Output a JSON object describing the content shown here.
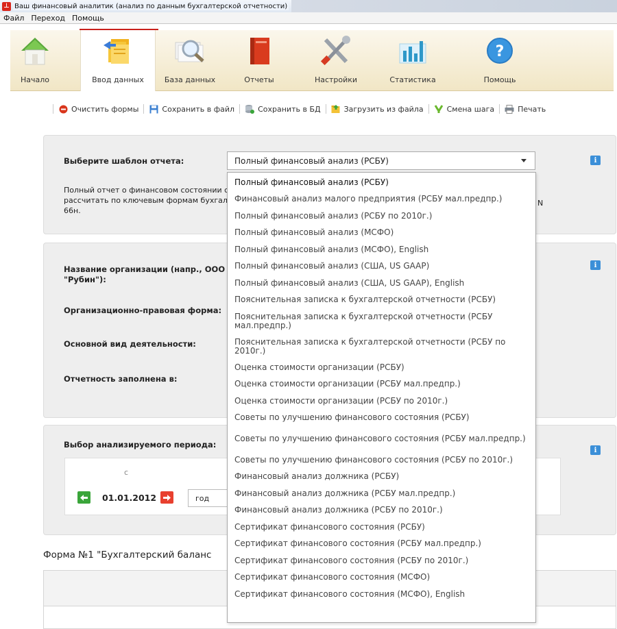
{
  "window": {
    "title": "Ваш финансовый аналитик (анализ по данным бухгалтерской отчетности)",
    "icon": "app-logo-icon"
  },
  "menu": {
    "items": [
      "Файл",
      "Переход",
      "Помощь"
    ]
  },
  "ribbon": {
    "items": [
      {
        "label": "Начало",
        "icon": "home-icon"
      },
      {
        "label": "Ввод данных",
        "icon": "data-entry-icon",
        "active": true
      },
      {
        "label": "База данных",
        "icon": "database-search-icon"
      },
      {
        "label": "Отчеты",
        "icon": "report-book-icon"
      },
      {
        "label": "Настройки",
        "icon": "tools-icon"
      },
      {
        "label": "Статистика",
        "icon": "statistics-icon"
      },
      {
        "label": "Помощь",
        "icon": "help-icon"
      }
    ]
  },
  "toolbar": {
    "clear": "Очистить формы",
    "save_file": "Сохранить в файл",
    "save_db": "Сохранить в БД",
    "load_file": "Загрузить из файла",
    "change_step": "Смена шага",
    "print": "Печать"
  },
  "template_panel": {
    "label": "Выберите шаблон отчета:",
    "selected": "Полный финансовый анализ (РСБУ)",
    "desc_line1": "Полный отчет о финансовом состоянии с",
    "desc_line2": "рассчитать по ключевым формам бухгал",
    "desc_line3": "66н.",
    "desc_tail": "N",
    "options": [
      "Полный финансовый анализ (РСБУ)",
      "Финансовый анализ малого предприятия (РСБУ мал.предпр.)",
      "Полный финансовый анализ (РСБУ по 2010г.)",
      "Полный финансовый анализ (МСФО)",
      "Полный финансовый анализ (МСФО), English",
      "Полный финансовый анализ (США, US GAAP)",
      "Полный финансовый анализ (США, US GAAP), English",
      "Пояснительная записка к бухгалтерской отчетности (РСБУ)",
      "Пояснительная записка к бухгалтерской отчетности (РСБУ мал.предпр.)",
      "Пояснительная записка к бухгалтерской отчетности (РСБУ по 2010г.)",
      "Оценка стоимости организации (РСБУ)",
      "Оценка стоимости организации (РСБУ мал.предпр.)",
      "Оценка стоимости организации (РСБУ по 2010г.)",
      "Советы по улучшению финансового состояния (РСБУ)",
      "Советы по улучшению финансового состояния (РСБУ мал.предпр.)",
      "Советы по улучшению финансового состояния (РСБУ по 2010г.)",
      "Финансовый анализ должника (РСБУ)",
      "Финансовый анализ должника (РСБУ мал.предпр.)",
      "Финансовый анализ должника (РСБУ по 2010г.)",
      "Сертификат финансового состояния (РСБУ)",
      "Сертификат финансового состояния (РСБУ мал.предпр.)",
      "Сертификат финансового состояния (РСБУ по 2010г.)",
      "Сертификат финансового состояния (МСФО)",
      "Сертификат финансового состояния (МСФО), English"
    ]
  },
  "org_panel": {
    "name_label_1": "Название организации (напр., ООО",
    "name_label_2": "\"Рубин\"):",
    "legal_form_label": "Организационно-правовая форма:",
    "activity_label": "Основной вид деятельности:",
    "filled_in_label": "Отчетность заполнена в:"
  },
  "period_panel": {
    "label": "Выбор анализируемого периода:",
    "from_label": "с",
    "date": "01.01.2012",
    "step": "год"
  },
  "balance": {
    "title": "Форма №1 \"Бухгалтерский баланс"
  },
  "colors": {
    "accent_red": "#c9201b",
    "info_blue": "#3b8fd8",
    "nav_green": "#3aa53a",
    "nav_red": "#e8402f"
  }
}
